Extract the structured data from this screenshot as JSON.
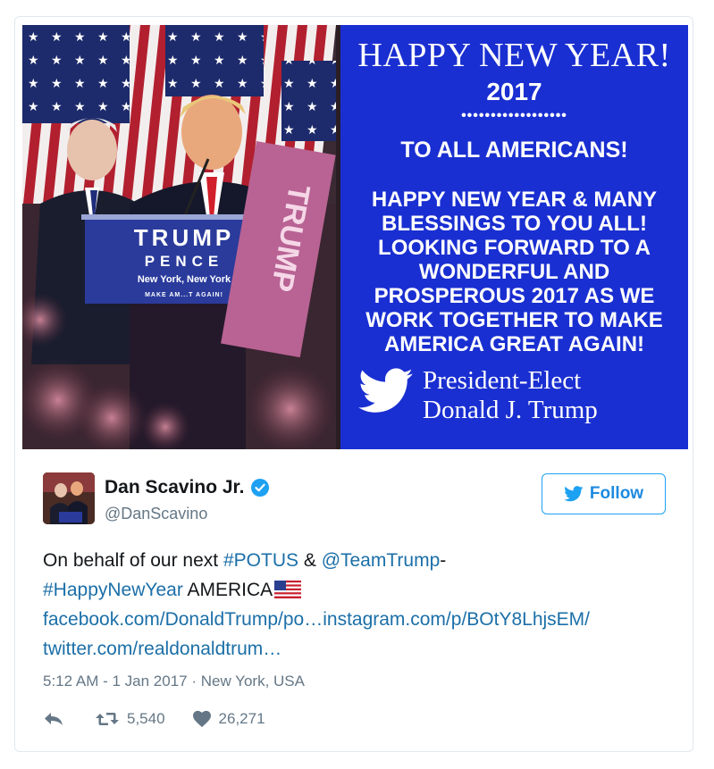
{
  "image": {
    "title": "HAPPY NEW YEAR!",
    "year": "2017",
    "dots": "••••••••••••••••••",
    "subtitle": "TO ALL AMERICANS!",
    "message_lines": [
      "HAPPY NEW YEAR & MANY",
      "BLESSINGS TO YOU ALL!",
      "LOOKING FORWARD TO A",
      "WONDERFUL AND",
      "PROSPEROUS 2017 AS WE",
      "WORK TOGETHER TO MAKE",
      "AMERICA GREAT AGAIN!"
    ],
    "signature_line1": "President-Elect",
    "signature_line2": "Donald J. Trump",
    "podium_line1": "TRUMP",
    "podium_line2": "PENCE",
    "podium_line3": "New York, New York",
    "podium_line4": "MAKE AM...T AGAIN!",
    "sign_text": "TRUMP",
    "banner_color": "#1a2fd1"
  },
  "tweet": {
    "author_name": "Dan Scavino Jr.",
    "author_handle": "@DanScavino",
    "follow_label": "Follow",
    "text_part1": "On behalf of our next ",
    "hashtag_potus": "#POTUS",
    "text_part2": " & ",
    "mention_teamtrump": "@TeamTrump",
    "text_part3": "-",
    "hashtag_happynewyear": "#HappyNewYear",
    "text_part4": " AMERICA",
    "link_facebook": "facebook.com/DonaldTrump/po…",
    "link_instagram": "instagram.com/p/BOtY8LhjsEM/",
    "link_twitter": "twitter.com/realdonaldtrum…",
    "timestamp": "5:12 AM - 1 Jan 2017",
    "separator": "·",
    "location": "New York, USA",
    "retweet_count": "5,540",
    "like_count": "26,271",
    "link_color": "#1b6fa8",
    "accent_color": "#1da1f2"
  },
  "icons": {
    "verified": "verified-badge-icon",
    "bird": "twitter-bird-icon",
    "reply": "reply-icon",
    "retweet": "retweet-icon",
    "like": "heart-icon",
    "flag": "us-flag-emoji"
  }
}
